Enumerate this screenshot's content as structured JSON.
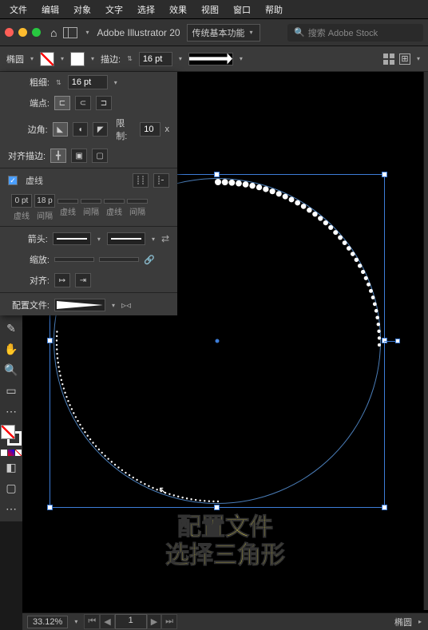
{
  "menu": {
    "file": "文件",
    "edit": "编辑",
    "object": "对象",
    "type": "文字",
    "select": "选择",
    "effect": "效果",
    "view": "视图",
    "window": "窗口",
    "help": "帮助"
  },
  "ctrl": {
    "app": "Adobe Illustrator 20",
    "profile": "传统基本功能",
    "search_ph": "搜索 Adobe Stock"
  },
  "opts": {
    "shape": "椭圆",
    "stroke_lbl": "描边:",
    "stroke_w": "16 pt"
  },
  "panel": {
    "weight_lbl": "粗细:",
    "weight": "16 pt",
    "cap_lbl": "端点:",
    "corner_lbl": "边角:",
    "limit_lbl": "限制:",
    "limit": "10",
    "limit_unit": "x",
    "align_lbl": "对齐描边:",
    "dash_lbl": "虚线",
    "dash_vals": [
      "0 pt",
      "18 p",
      "",
      "",
      "",
      ""
    ],
    "dash_names": [
      "虚线",
      "间隔",
      "虚线",
      "间隔",
      "虚线",
      "间隔"
    ],
    "arrow_lbl": "箭头:",
    "scale_lbl": "缩放:",
    "align_arrow_lbl": "对齐:",
    "profile_lbl": "配置文件:"
  },
  "status": {
    "zoom": "33.12%",
    "page": "1",
    "sel": "椭圆"
  },
  "caption": {
    "l1": "配置文件",
    "l2": "选择三角形"
  }
}
